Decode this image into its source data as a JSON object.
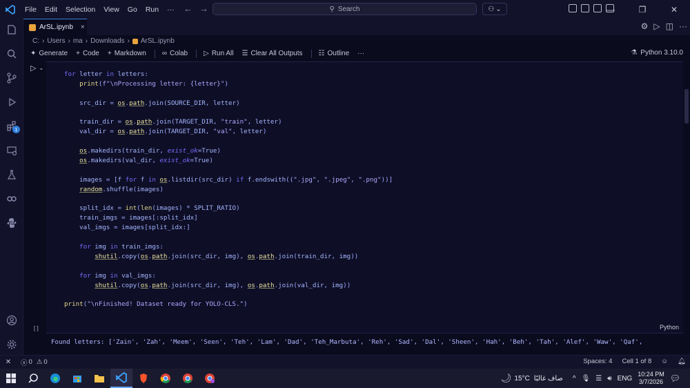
{
  "titlebar": {
    "menu": [
      "File",
      "Edit",
      "Selection",
      "View",
      "Go",
      "Run",
      "···"
    ],
    "search_label": "Search"
  },
  "tab": {
    "title": "ArSL.ipynb",
    "close": "×"
  },
  "breadcrumb": [
    "C:",
    "Users",
    "ma",
    "Downloads",
    "ArSL.ipynb"
  ],
  "toolbar": {
    "generate": "Generate",
    "code": "Code",
    "markdown": "Markdown",
    "colab": "Colab",
    "run_all": "Run All",
    "clear_all": "Clear All Outputs",
    "outline": "Outline",
    "more": "···",
    "kernel": "Python 3.10.0"
  },
  "cell": {
    "language": "Python",
    "collapse": "[ ]",
    "code_lines": [
      "for letter in letters:",
      "    print(f\"\\nProcessing letter: {letter}\")",
      "",
      "    src_dir = os.path.join(SOURCE_DIR, letter)",
      "",
      "    train_dir = os.path.join(TARGET_DIR, \"train\", letter)",
      "    val_dir = os.path.join(TARGET_DIR, \"val\", letter)",
      "",
      "    os.makedirs(train_dir, exist_ok=True)",
      "    os.makedirs(val_dir, exist_ok=True)",
      "",
      "    images = [f for f in os.listdir(src_dir) if f.endswith((\".jpg\", \".jpeg\", \".png\"))]",
      "    random.shuffle(images)",
      "",
      "    split_idx = int(len(images) * SPLIT_RATIO)",
      "    train_imgs = images[:split_idx]",
      "    val_imgs = images[split_idx:]",
      "",
      "    for img in train_imgs:",
      "        shutil.copy(os.path.join(src_dir, img), os.path.join(train_dir, img))",
      "",
      "    for img in val_imgs:",
      "        shutil.copy(os.path.join(src_dir, img), os.path.join(val_dir, img))",
      "",
      "print(\"\\nFinished! Dataset ready for YOLO-CLS.\")"
    ],
    "output": "Found letters: ['Zain', 'Zah', 'Meem', 'Seen', 'Teh', 'Lam', 'Dad', 'Teh_Marbuta', 'Reh', 'Sad', 'Dal', 'Sheen', 'Hah', 'Beh', 'Tah', 'Alef', 'Waw', 'Qaf',"
  },
  "activity_badge": "1",
  "statusbar": {
    "errors": "0",
    "warnings": "0",
    "spaces": "Spaces: 4",
    "cell_pos": "Cell 1 of 8"
  },
  "taskbar": {
    "temperature": "15°C",
    "weather": "صاف غالبًا",
    "lang": "ENG",
    "time": "10:24 PM",
    "date": "3/7/2026"
  }
}
